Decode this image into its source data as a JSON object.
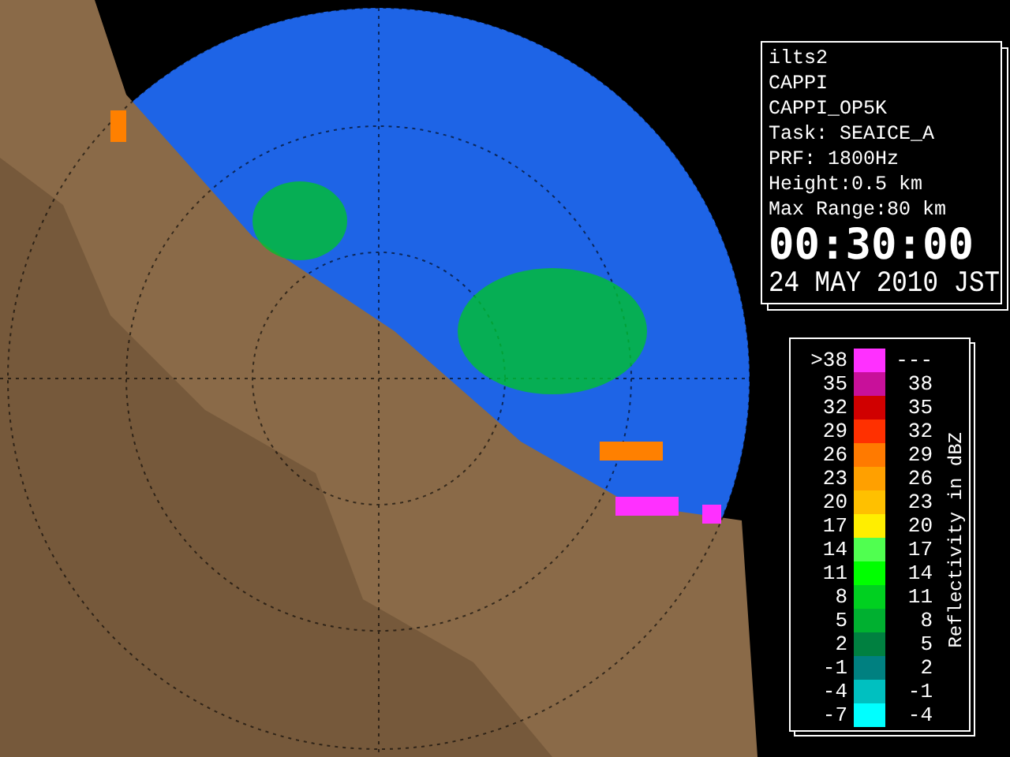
{
  "info": {
    "lines": [
      "ilts2",
      "CAPPI",
      "CAPPI_OP5K",
      "Task: SEAICE_A",
      "PRF: 1800Hz",
      "Height:0.5 km",
      "Max Range:80 km"
    ],
    "time": "00:30:00",
    "date": "24 MAY 2010 JST"
  },
  "legend": {
    "title": "Reflectivity in dBZ",
    "rows": [
      {
        "low": ">38",
        "high": "---",
        "color": "#ff30ff"
      },
      {
        "low": "35",
        "high": "38",
        "color": "#c8109a"
      },
      {
        "low": "32",
        "high": "35",
        "color": "#d00000"
      },
      {
        "low": "29",
        "high": "32",
        "color": "#ff3000"
      },
      {
        "low": "26",
        "high": "29",
        "color": "#ff7a00"
      },
      {
        "low": "23",
        "high": "26",
        "color": "#ffa000"
      },
      {
        "low": "20",
        "high": "23",
        "color": "#ffc000"
      },
      {
        "low": "17",
        "high": "20",
        "color": "#ffee00"
      },
      {
        "low": "14",
        "high": "17",
        "color": "#50ff50"
      },
      {
        "low": "11",
        "high": "14",
        "color": "#00ff00"
      },
      {
        "low": "8",
        "high": "11",
        "color": "#00d020"
      },
      {
        "low": "5",
        "high": "8",
        "color": "#00b030"
      },
      {
        "low": "2",
        "high": "5",
        "color": "#008040"
      },
      {
        "low": "-1",
        "high": "2",
        "color": "#008080"
      },
      {
        "low": "-4",
        "high": "-1",
        "color": "#00c0c0"
      },
      {
        "low": "-7",
        "high": "-4",
        "color": "#00ffff"
      }
    ]
  }
}
